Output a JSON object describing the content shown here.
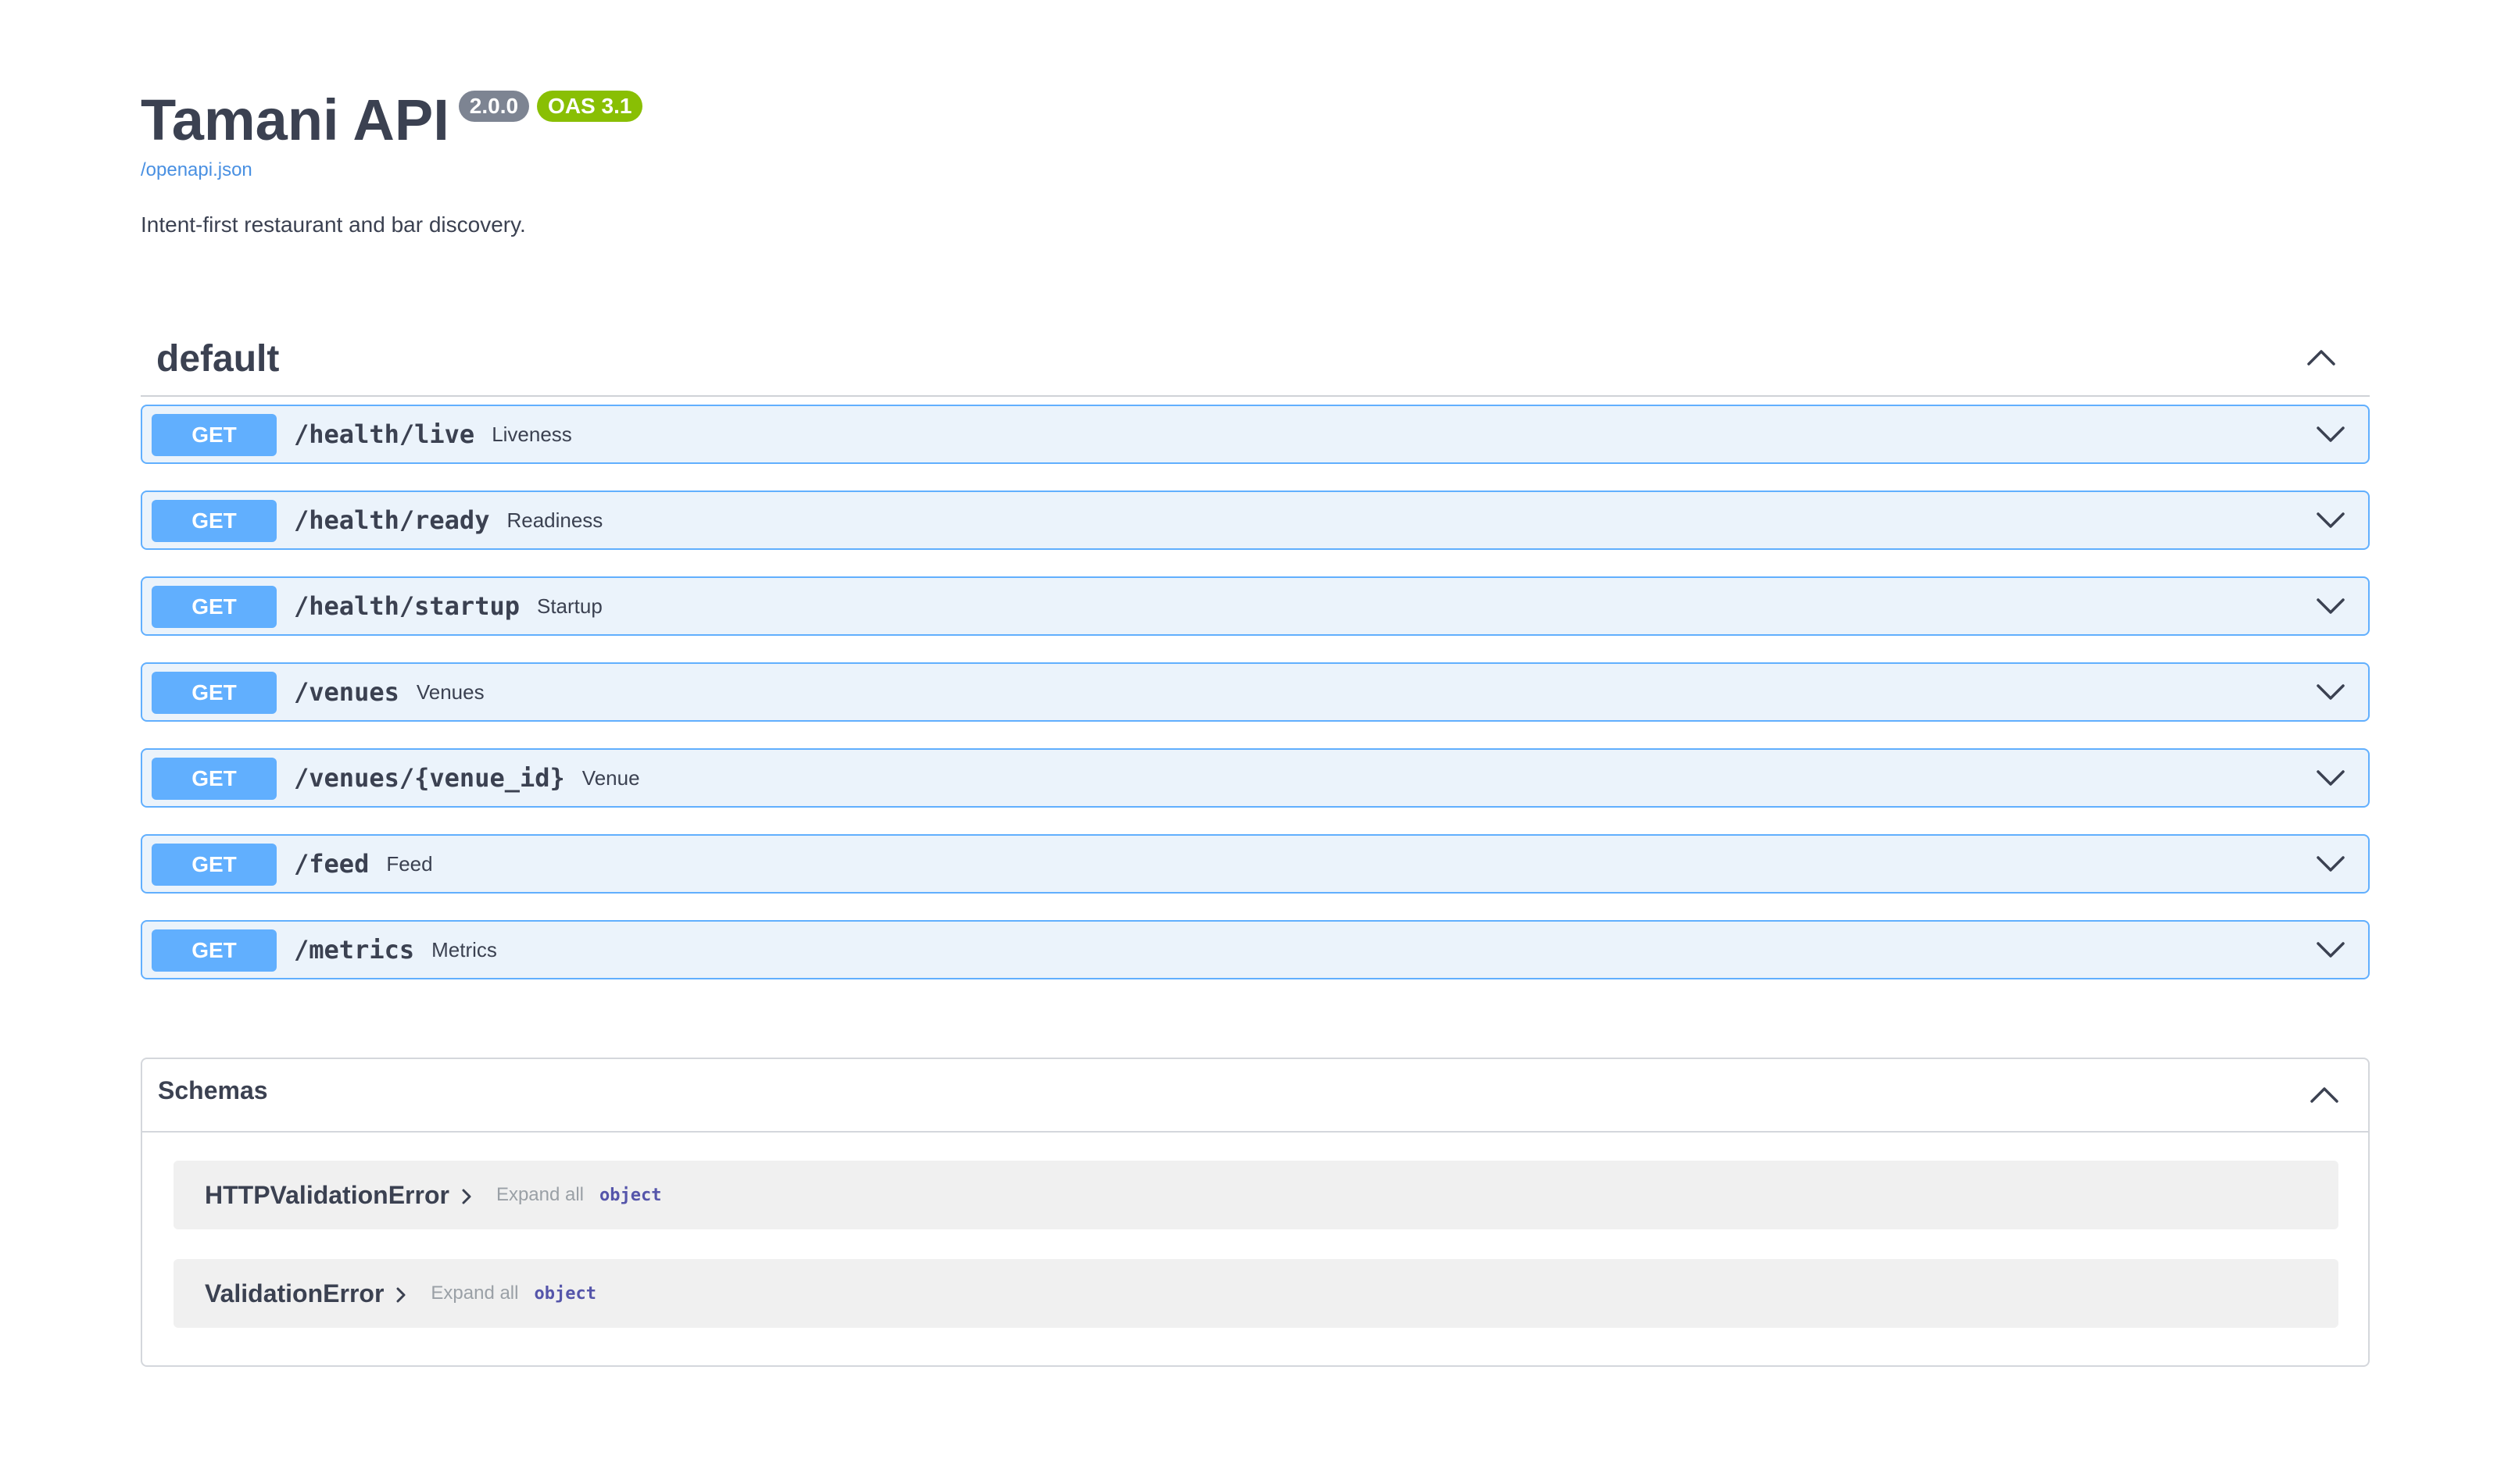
{
  "info": {
    "title": "Tamani API",
    "version": "2.0.0",
    "oas_version": "OAS 3.1",
    "spec_link": "/openapi.json",
    "description": "Intent-first restaurant and bar discovery."
  },
  "tag": {
    "name": "default"
  },
  "operations": [
    {
      "method": "GET",
      "path": "/health/live",
      "summary": "Liveness"
    },
    {
      "method": "GET",
      "path": "/health/ready",
      "summary": "Readiness"
    },
    {
      "method": "GET",
      "path": "/health/startup",
      "summary": "Startup"
    },
    {
      "method": "GET",
      "path": "/venues",
      "summary": "Venues"
    },
    {
      "method": "GET",
      "path": "/venues/{venue_id}",
      "summary": "Venue"
    },
    {
      "method": "GET",
      "path": "/feed",
      "summary": "Feed"
    },
    {
      "method": "GET",
      "path": "/metrics",
      "summary": "Metrics"
    }
  ],
  "schemas": {
    "title": "Schemas",
    "items": [
      {
        "name": "HTTPValidationError",
        "expand_label": "Expand all",
        "type": "object"
      },
      {
        "name": "ValidationError",
        "expand_label": "Expand all",
        "type": "object"
      }
    ]
  },
  "colors": {
    "get_method": "#61affe",
    "get_background": "#ebf3fb",
    "version_badge": "#7d8492",
    "oas_badge": "#89bf04",
    "link": "#4990e2"
  },
  "icons": {
    "tag_toggle": "chevron-up-icon",
    "operation_toggle": "chevron-down-icon",
    "schemas_toggle": "chevron-up-icon",
    "model_expand": "chevron-right-icon"
  }
}
